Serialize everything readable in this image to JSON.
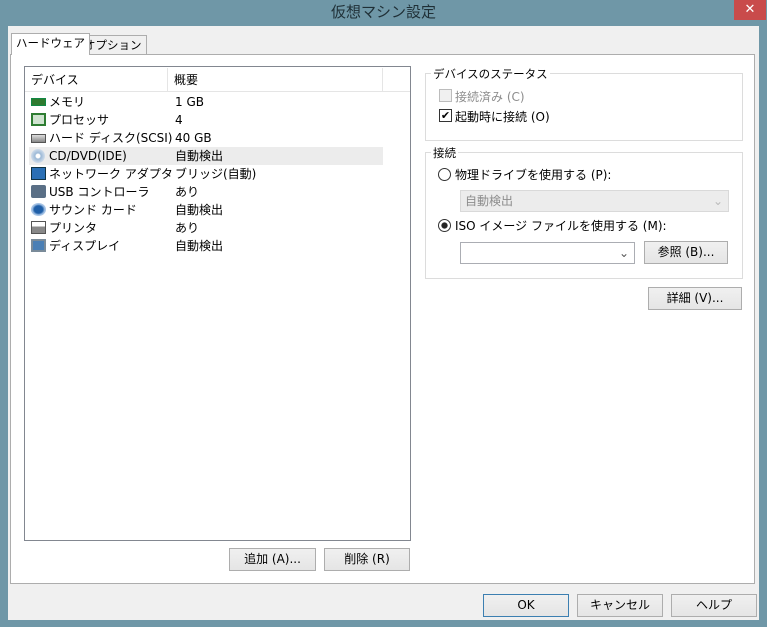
{
  "window": {
    "title": "仮想マシン設定",
    "close": "✕"
  },
  "tabs": [
    {
      "label": "ハードウェア"
    },
    {
      "label": "オプション"
    }
  ],
  "device_list": {
    "headers": [
      "デバイス",
      "概要"
    ],
    "rows": [
      {
        "icon": "memory-icon",
        "device": "メモリ",
        "summary": "1 GB"
      },
      {
        "icon": "processor-icon",
        "device": "プロセッサ",
        "summary": "4"
      },
      {
        "icon": "hard-disk-icon",
        "device": "ハード ディスク(SCSI)",
        "summary": "40 GB"
      },
      {
        "icon": "cd-dvd-icon",
        "device": "CD/DVD(IDE)",
        "summary": "自動検出"
      },
      {
        "icon": "network-adapter-icon",
        "device": "ネットワーク アダプタ",
        "summary": "ブリッジ(自動)"
      },
      {
        "icon": "usb-icon",
        "device": "USB コントローラ",
        "summary": "あり"
      },
      {
        "icon": "sound-icon",
        "device": "サウンド カード",
        "summary": "自動検出"
      },
      {
        "icon": "printer-icon",
        "device": "プリンタ",
        "summary": "あり"
      },
      {
        "icon": "display-icon",
        "device": "ディスプレイ",
        "summary": "自動検出"
      }
    ],
    "add": "追加 (A)...",
    "remove": "削除 (R)"
  },
  "status": {
    "title": "デバイスのステータス",
    "connected": "接続済み (C)",
    "connect_on_start": "起動時に接続 (O)"
  },
  "connection": {
    "title": "接続",
    "physical": "物理ドライブを使用する (P):",
    "physical_value": "自動検出",
    "iso": "ISO イメージ ファイルを使用する (M):",
    "iso_value": "",
    "browse": "参照 (B)..."
  },
  "advanced": "詳細 (V)...",
  "footer": {
    "ok": "OK",
    "cancel": "キャンセル",
    "help": "ヘルプ"
  }
}
